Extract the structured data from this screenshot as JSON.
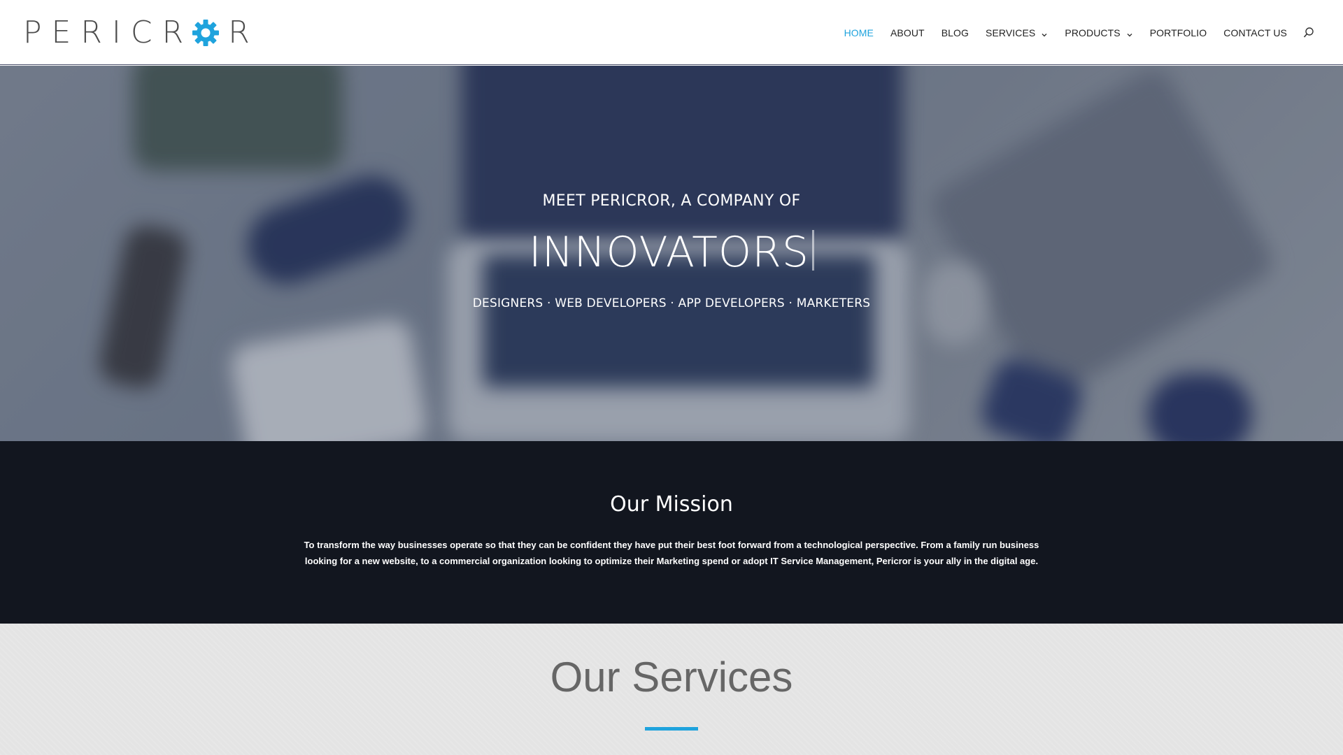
{
  "logo": {
    "text_left": "PERICR",
    "text_right": "R",
    "gear_icon": "gear-icon",
    "brand_color": "#1fa3dd"
  },
  "nav": {
    "items": [
      {
        "label": "HOME",
        "active": true
      },
      {
        "label": "ABOUT"
      },
      {
        "label": "BLOG"
      },
      {
        "label": "SERVICES",
        "dropdown": true
      },
      {
        "label": "PRODUCTS",
        "dropdown": true
      },
      {
        "label": "PORTFOLIO"
      },
      {
        "label": "CONTACT US"
      }
    ],
    "search_icon": "search-icon",
    "active_color": "#1fa3dd"
  },
  "hero": {
    "subtitle": "MEET PERICROR, A COMPANY OF",
    "title": "INNOVATORS",
    "tagline": "DESIGNERS · WEB DEVELOPERS · APP DEVELOPERS · MARKETERS"
  },
  "mission": {
    "heading": "Our Mission",
    "body": "To transform the way businesses operate so that they can be confident they have put their best foot forward from a technological perspective. From a family run business looking for a new website, to a commercial organization looking to optimize their Marketing spend or adopt IT Service Management, Pericror is your ally in the digital age.",
    "background": "#12161f"
  },
  "services": {
    "heading": "Our Services",
    "accent": "#1fa3dd"
  }
}
